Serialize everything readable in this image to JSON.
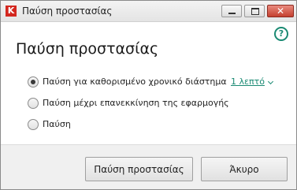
{
  "window": {
    "title": "Παύση προστασίας",
    "app_icon_letter": "K",
    "close_glyph": "✕"
  },
  "help": {
    "glyph": "?"
  },
  "dialog": {
    "heading": "Παύση προστασίας",
    "options": [
      {
        "label": "Παύση για καθορισμένο χρονικό διάστημα",
        "selected": true,
        "duration_value": "1 λεπτό"
      },
      {
        "label": "Παύση μέχρι επανεκκίνηση της εφαρμογής",
        "selected": false
      },
      {
        "label": "Παύση",
        "selected": false
      }
    ]
  },
  "buttons": {
    "pause_label": "Παύση προστασίας",
    "cancel_label": "Άκυρο"
  },
  "colors": {
    "accent": "#1a8a73",
    "brand": "#d3271f"
  }
}
